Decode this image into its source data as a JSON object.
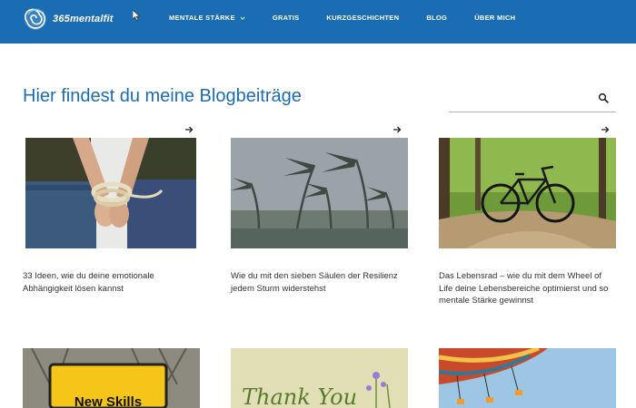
{
  "header": {
    "logo_text": "365mentalfit",
    "nav": [
      {
        "label": "MENTALE STÄRKE",
        "has_dropdown": true
      },
      {
        "label": "GRATIS"
      },
      {
        "label": "KURZGESCHICHTEN"
      },
      {
        "label": "BLOG"
      },
      {
        "label": "ÜBER MICH"
      }
    ]
  },
  "main": {
    "title": "Hier findest du meine Blogbeiträge",
    "search": {
      "value": "",
      "placeholder": ""
    }
  },
  "posts": [
    {
      "title": "33 Ideen, wie du deine emotionale Abhängigkeit lösen kannst",
      "image": "tied-hands-photo"
    },
    {
      "title": "Wie du mit den sieben Säulen der Resilienz jedem Sturm widerstehst",
      "image": "palm-trees-storm-photo"
    },
    {
      "title": "Das Lebensrad – wie du mit dem Wheel of Life deine Lebensbereiche optimierst und so mentale Stärke gewinnst",
      "image": "bicycle-forest-photo"
    },
    {
      "title": "",
      "image": "new-skills-sign-photo",
      "image_text": "New Skills"
    },
    {
      "title": "",
      "image": "thank-you-card-photo",
      "image_text": "Thank You"
    },
    {
      "title": "",
      "image": "carousel-ride-photo"
    }
  ],
  "colors": {
    "header_bg": "#1b6db3",
    "title": "#1b6db3",
    "text": "#333333"
  }
}
